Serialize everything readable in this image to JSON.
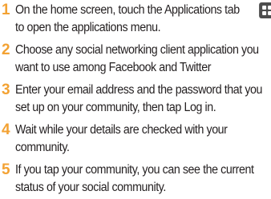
{
  "colors": {
    "step_number": "#f3a233",
    "text": "#231f20",
    "icon_background": "#4d4d4d"
  },
  "steps": [
    {
      "number": "1",
      "lines": [
        "On the home screen, touch the Applications tab",
        "to open the applications menu."
      ],
      "icon": "applications-grid-icon"
    },
    {
      "number": "2",
      "lines": [
        "Choose any social networking client application you",
        "want to use among Facebook and Twitter"
      ]
    },
    {
      "number": "3",
      "lines": [
        "Enter your email address and the password that you",
        "set up on your community, then tap Log in."
      ]
    },
    {
      "number": "4",
      "lines": [
        "Wait while your details are checked with your",
        "community."
      ]
    },
    {
      "number": "5",
      "lines": [
        "If you tap your community, you can see the current",
        "status of your social community."
      ]
    }
  ]
}
